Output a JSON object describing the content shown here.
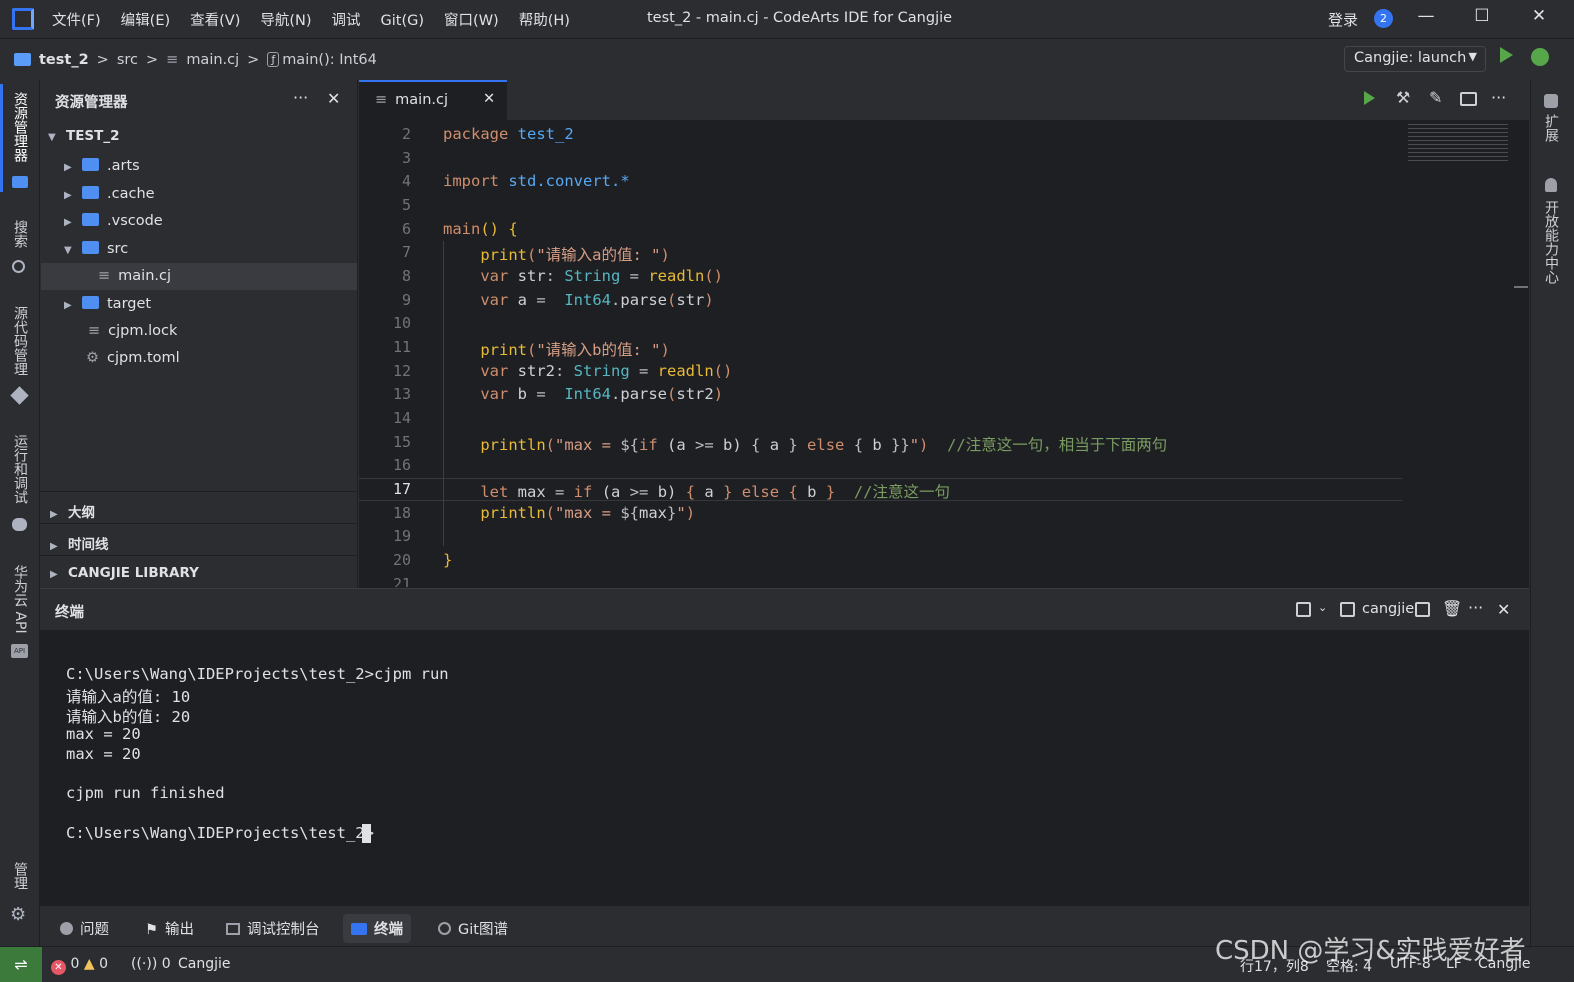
{
  "menu": [
    "文件(F)",
    "编辑(E)",
    "查看(V)",
    "导航(N)",
    "调试",
    "Git(G)",
    "窗口(W)",
    "帮助(H)"
  ],
  "window_title": "test_2 - main.cj - CodeArts IDE for Cangjie",
  "login": "登录",
  "notif_count": "2",
  "breadcrumb": [
    "test_2",
    ">",
    "src",
    ">",
    "main.cj",
    ">",
    "main(): Int64"
  ],
  "run_config": "Cangjie: launch",
  "activity": [
    "资源管理器",
    "搜索",
    "源代码管理",
    "运行和调试",
    "华为云 API",
    "管理"
  ],
  "right_activity": [
    "扩展",
    "开放能力中心"
  ],
  "explorer": {
    "title": "资源管理器",
    "root": "TEST_2",
    "items": [
      ".arts",
      ".cache",
      ".vscode",
      "src",
      "main.cj",
      "target",
      "cjpm.lock",
      "cjpm.toml"
    ],
    "sections": [
      "大纲",
      "时间线",
      "CANGJIE LIBRARY"
    ]
  },
  "tab": {
    "label": "main.cj"
  },
  "line_numbers": [
    "2",
    "3",
    "4",
    "5",
    "6",
    "7",
    "8",
    "9",
    "10",
    "11",
    "12",
    "13",
    "14",
    "15",
    "16",
    "17",
    "18",
    "19",
    "20",
    "21"
  ],
  "panel": {
    "title": "终端",
    "shell": "cangjie",
    "lines": [
      "C:\\Users\\Wang\\IDEProjects\\test_2>cjpm run",
      "请输入a的值: 10",
      "请输入b的值: 20",
      "max = 20",
      "max = 20",
      "",
      "cjpm run finished",
      "",
      "C:\\Users\\Wang\\IDEProjects\\test_2>"
    ]
  },
  "bottom_tabs": [
    "问题",
    "输出",
    "调试控制台",
    "终端",
    "Git图谱"
  ],
  "status": {
    "errors": "0",
    "warnings": "0",
    "ports": "0",
    "lang_left": "Cangjie",
    "position": "行17，列8",
    "spaces": "空格: 4",
    "encoding": "UTF-8",
    "eol": "LF",
    "lang": "Cangjie"
  },
  "watermark": "CSDN @学习&实践爱好者"
}
